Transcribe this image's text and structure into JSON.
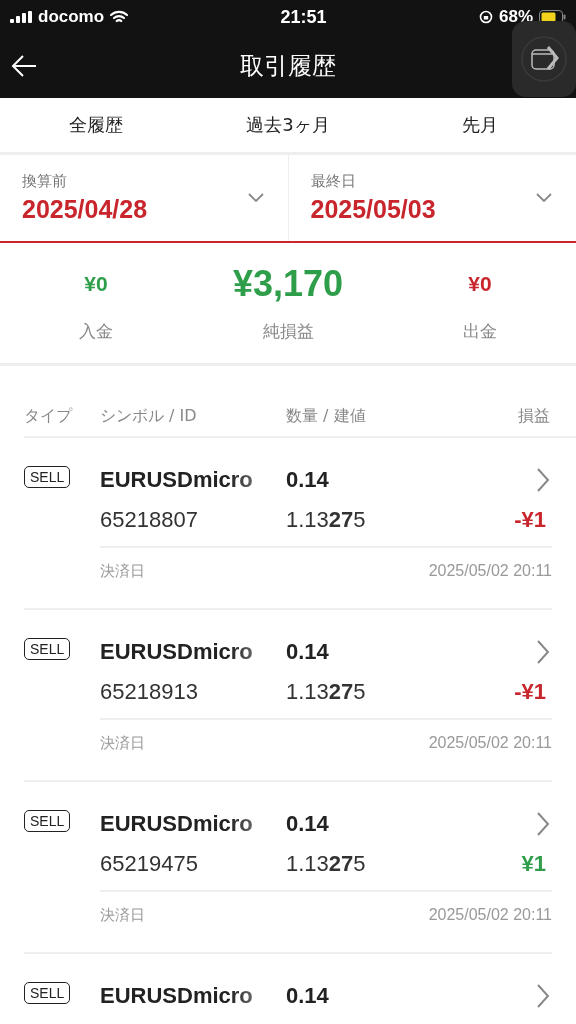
{
  "status_bar": {
    "carrier": "docomo",
    "time": "21:51",
    "battery": "68%"
  },
  "header": {
    "title": "取引履歴"
  },
  "tabs": [
    {
      "label": "全履歴"
    },
    {
      "label": "過去3ヶ月"
    },
    {
      "label": "先月"
    }
  ],
  "date_filters": [
    {
      "label": "換算前",
      "value": "2025/04/28"
    },
    {
      "label": "最終日",
      "value": "2025/05/03"
    }
  ],
  "summary": [
    {
      "label": "入金",
      "value": "¥0",
      "kind": "positive"
    },
    {
      "label": "純損益",
      "value": "¥3,170",
      "kind": "main"
    },
    {
      "label": "出金",
      "value": "¥0",
      "kind": "negative"
    }
  ],
  "columns": [
    "タイプ",
    "シンボル / ID",
    "数量 / 建値",
    "損益"
  ],
  "trades": [
    {
      "type": "SELL",
      "symbol": "EURUSDmicro",
      "volume": "0.14",
      "id": "65218807",
      "price": "1.13**27**5",
      "pnl": "-¥1",
      "profit": false,
      "close_label": "決済日",
      "close_time": "2025/05/02 20:11"
    },
    {
      "type": "SELL",
      "symbol": "EURUSDmicro",
      "volume": "0.14",
      "id": "65218913",
      "price": "1.13**27**5",
      "pnl": "-¥1",
      "profit": false,
      "close_label": "決済日",
      "close_time": "2025/05/02 20:11"
    },
    {
      "type": "SELL",
      "symbol": "EURUSDmicro",
      "volume": "0.14",
      "id": "65219475",
      "price": "1.13**27**5",
      "pnl": "¥1",
      "profit": true,
      "close_label": "決済日",
      "close_time": "2025/05/02 20:11"
    },
    {
      "type": "SELL",
      "symbol": "EURUSDmicro",
      "volume": "0.14"
    }
  ]
}
